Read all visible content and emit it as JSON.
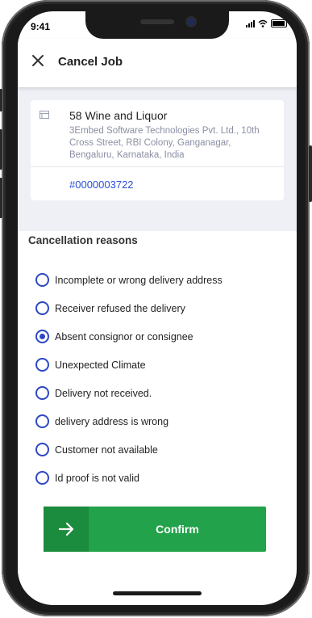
{
  "status_bar": {
    "time": "9:41"
  },
  "header": {
    "title": "Cancel Job",
    "close_icon": "close-icon"
  },
  "order": {
    "store_name": "58 Wine and Liquor",
    "address": "3Embed Software Technologies Pvt. Ltd., 10th Cross Street, RBI Colony, Ganganagar, Bengaluru, Karnataka, India",
    "order_id": "#0000003722",
    "store_icon": "store-icon"
  },
  "cancellation": {
    "title": "Cancellation reasons",
    "selected_index": 2,
    "reasons": [
      "Incomplete or wrong  delivery address",
      "Receiver refused the delivery",
      "Absent consignor or consignee",
      "Unexpected Climate",
      "Delivery not received.",
      "delivery address is wrong",
      "Customer not available",
      "Id proof is not valid"
    ]
  },
  "confirm": {
    "label": "Confirm",
    "icon": "arrow-right-icon"
  },
  "colors": {
    "accent_blue": "#2e46c6",
    "confirm_green": "#22a24a",
    "confirm_dark_green": "#1b8b3d",
    "order_area_bg": "#eef0f6"
  }
}
